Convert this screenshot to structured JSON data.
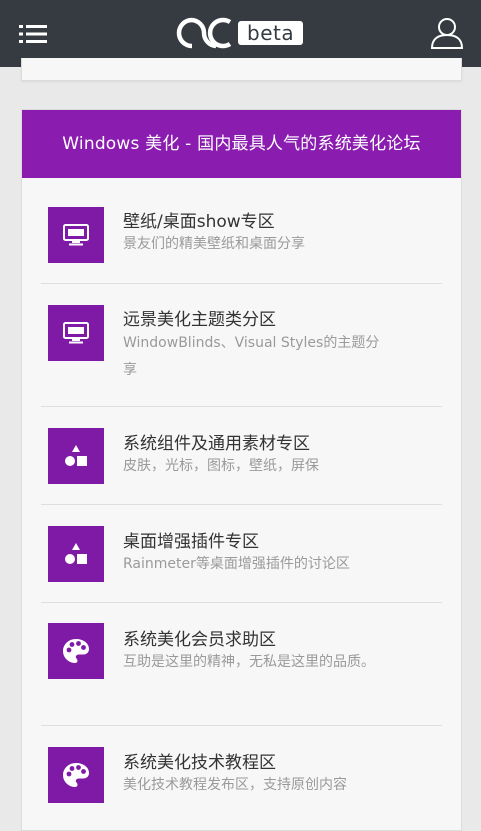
{
  "header": {
    "logo_text": "beta",
    "menu_icon": "menu-icon",
    "user_icon": "user-icon"
  },
  "forum": {
    "title": "Windows 美化 - 国内最具人气的系统美化论坛",
    "accent_color": "#8b1cb0",
    "items": [
      {
        "title": "壁纸/桌面show专区",
        "desc": "景友们的精美壁纸和桌面分享",
        "icon": "monitor-icon"
      },
      {
        "title": "远景美化主题类分区",
        "desc": "WindowBlinds、Visual Styles的主题分享",
        "icon": "monitor-icon"
      },
      {
        "title": "系统组件及通用素材专区",
        "desc": "皮肤，光标，图标，壁纸，屏保",
        "icon": "shapes-icon"
      },
      {
        "title": "桌面增强插件专区",
        "desc": "Rainmeter等桌面增强插件的讨论区",
        "icon": "shapes-icon"
      },
      {
        "title": "系统美化会员求助区",
        "desc": "互助是这里的精神，无私是这里的品质。",
        "icon": "palette-icon"
      },
      {
        "title": "系统美化技术教程区",
        "desc": "美化技术教程发布区，支持原创内容",
        "icon": "palette-icon"
      }
    ]
  }
}
